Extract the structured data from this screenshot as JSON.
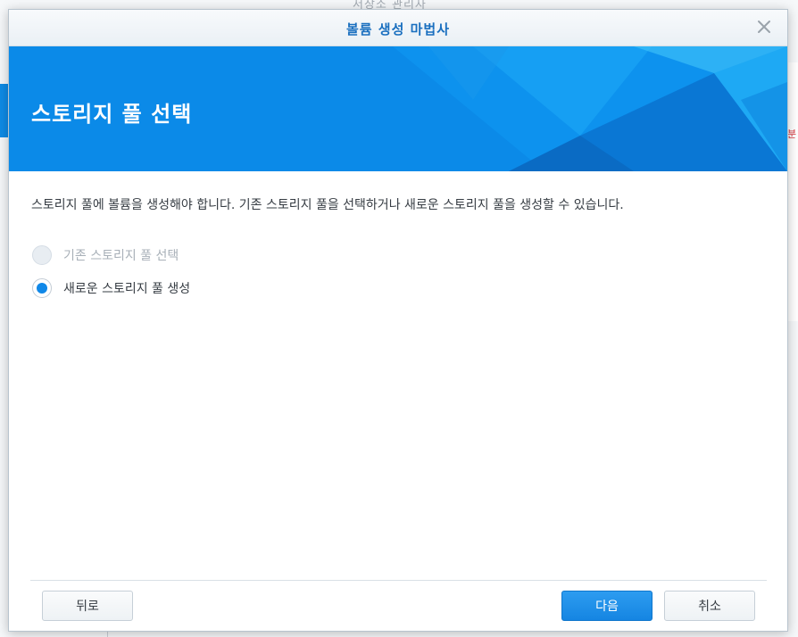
{
  "background": {
    "window_title": "저장소 관리자",
    "red_mark": "분"
  },
  "dialog": {
    "title": "볼륨 생성 마법사",
    "close_icon": "close-icon",
    "banner_title": "스토리지 풀 선택",
    "description": "스토리지 풀에 볼륨을 생성해야 합니다. 기존 스토리지 풀을 선택하거나 새로운 스토리지 풀을 생성할 수 있습니다.",
    "options": [
      {
        "label": "기존 스토리지 풀 선택",
        "disabled": true,
        "checked": false
      },
      {
        "label": "새로운 스토리지 풀 생성",
        "disabled": false,
        "checked": true
      }
    ],
    "buttons": {
      "back": "뒤로",
      "next": "다음",
      "cancel": "취소"
    }
  },
  "colors": {
    "accent": "#0b8ae8",
    "title_text": "#1a6fbf",
    "radio_checked": "#1088e8"
  }
}
